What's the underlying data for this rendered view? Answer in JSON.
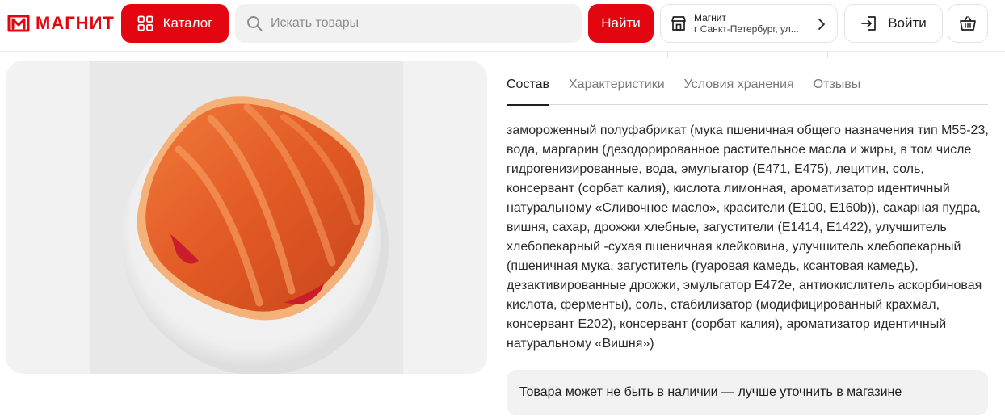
{
  "header": {
    "logo_text": "МАГНИТ",
    "catalog_label": "Каталог",
    "search_placeholder": "Искать товары",
    "search_value": "",
    "find_label": "Найти",
    "store_name": "Магнит",
    "store_address": "г Санкт-Петербург, ул...",
    "login_label": "Войти",
    "brand_color": "#e30611"
  },
  "icons": {
    "logo": "magnit-logo-icon",
    "catalog": "grid-icon",
    "search": "search-icon",
    "store": "store-icon",
    "chevron": "chevron-right-icon",
    "login": "login-icon",
    "cart": "basket-icon"
  },
  "tabs": [
    {
      "label": "Состав",
      "active": true
    },
    {
      "label": "Характеристики",
      "active": false
    },
    {
      "label": "Условия хранения",
      "active": false
    },
    {
      "label": "Отзывы",
      "active": false
    }
  ],
  "composition": "замороженный полуфабрикат (мука пшеничная общего назначения тип М55-23, вода, маргарин (дезодорированное растительное масла и жиры, в том числе гидрогенизированные, вода, эмульгатор (Е471, Е475), лецитин, соль, консервант (сорбат калия), кислота лимонная, ароматизатор идентичный натуральному «Сливочное масло», красители (Е100, Е160b)), сахарная пудра, вишня, сахар, дрожжи хлебные, загустители (Е1414, Е1422), улучшитель хлебопекарный -сухая пшеничная клейковина, улучшитель хлебопекарный (пшеничная мука, загуститель (гуаровая камедь, ксантовая камедь), дезактивированные дрожжи, эмульгатор Е472е, антиокислитель аскорбиновая кислота, ферменты), соль, стабилизатор (модифицированный крахмал, консервант Е202), консервант (сорбат калия), ароматизатор идентичный натуральному «Вишня»)",
  "notice": "Товара может не быть в наличии — лучше уточнить в магазине"
}
